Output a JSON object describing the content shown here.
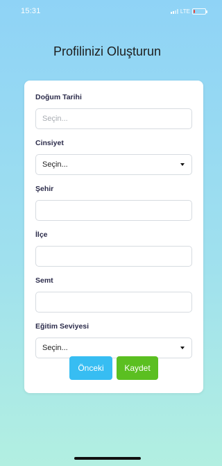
{
  "status_bar": {
    "time": "15:31",
    "network": "LTE",
    "battery_color": "#e8453c",
    "battery_level": 0.1
  },
  "page": {
    "title": "Profilinizi Oluşturun"
  },
  "form": {
    "birth_date": {
      "label": "Doğum Tarihi",
      "placeholder": "Seçin...",
      "value": ""
    },
    "gender": {
      "label": "Cinsiyet",
      "selected": "Seçin..."
    },
    "city": {
      "label": "Şehir",
      "value": ""
    },
    "district": {
      "label": "İlçe",
      "value": ""
    },
    "neighborhood": {
      "label": "Semt",
      "value": ""
    },
    "education": {
      "label": "Eğitim Seviyesi",
      "selected": "Seçin..."
    }
  },
  "buttons": {
    "previous_label": "Önceki",
    "previous_color": "#37bdf2",
    "save_label": "Kaydet",
    "save_color": "#5bbf21"
  }
}
